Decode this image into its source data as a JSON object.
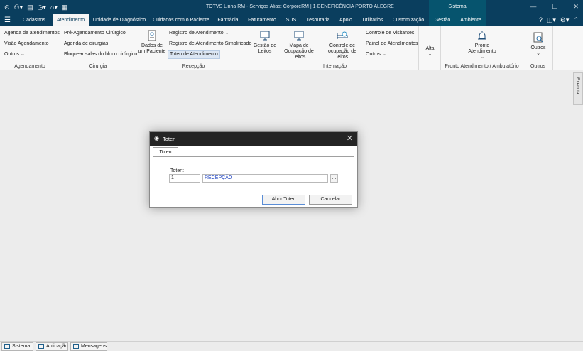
{
  "titlebar": {
    "app_title": "TOTVS Linha RM - Serviços  Alias: CorporeRM | 1-BENEFICÊNCIA PORTO ALEGRE",
    "context_caption": "Sistema"
  },
  "tabs": [
    "Cadastros",
    "Atendimento",
    "Unidade de Diagnóstico",
    "Cuidados com o Paciente",
    "Farmácia",
    "Faturamento",
    "SUS",
    "Tesouraria",
    "Apoio",
    "Utilitários",
    "Customização",
    "Gestão",
    "Ambiente"
  ],
  "ribbon": {
    "agendamento": {
      "title": "Agendamento",
      "items": [
        "Agenda de atendimentos",
        "Visão Agendamento",
        "Outros"
      ]
    },
    "cirurgia": {
      "title": "Cirurgia",
      "items": [
        "Pré-Agendamento Cirúrgico",
        "Agenda de cirurgias",
        "Bloquear salas do bloco cirúrgico"
      ]
    },
    "recepcao": {
      "title": "Recepção",
      "big_button": "Dados de um Paciente",
      "items": [
        "Registro de Atendimento",
        "Registro de Atendimento Simplificado",
        "Toten de Atendimento"
      ]
    },
    "internacao": {
      "title": "Internação",
      "big_buttons": [
        "Gestão de Leitos",
        "Mapa de Ocupação de Leitos",
        "Controle de ocupação de leitos"
      ],
      "items": [
        "Controle de Visitantes",
        "Painel de Atendimentos",
        "Outros"
      ]
    },
    "alta": {
      "label": "Alta"
    },
    "pronto": {
      "title": "Pronto Atendimento / Ambulatório",
      "big_button": "Pronto Atendimento"
    },
    "outros": {
      "title": "Outros",
      "big_button": "Outros"
    }
  },
  "side_panel": {
    "label": "Executar"
  },
  "dialog": {
    "title": "Toten",
    "tab": "Toten",
    "field_label": "Toten:",
    "code_value": "1",
    "desc_value": "RECEPÇÃO",
    "lookup_label": "...",
    "ok_label": "Abrir Toten",
    "cancel_label": "Cancelar"
  },
  "statusbar": [
    "Sistema",
    "Aplicação",
    "Mensagens"
  ]
}
